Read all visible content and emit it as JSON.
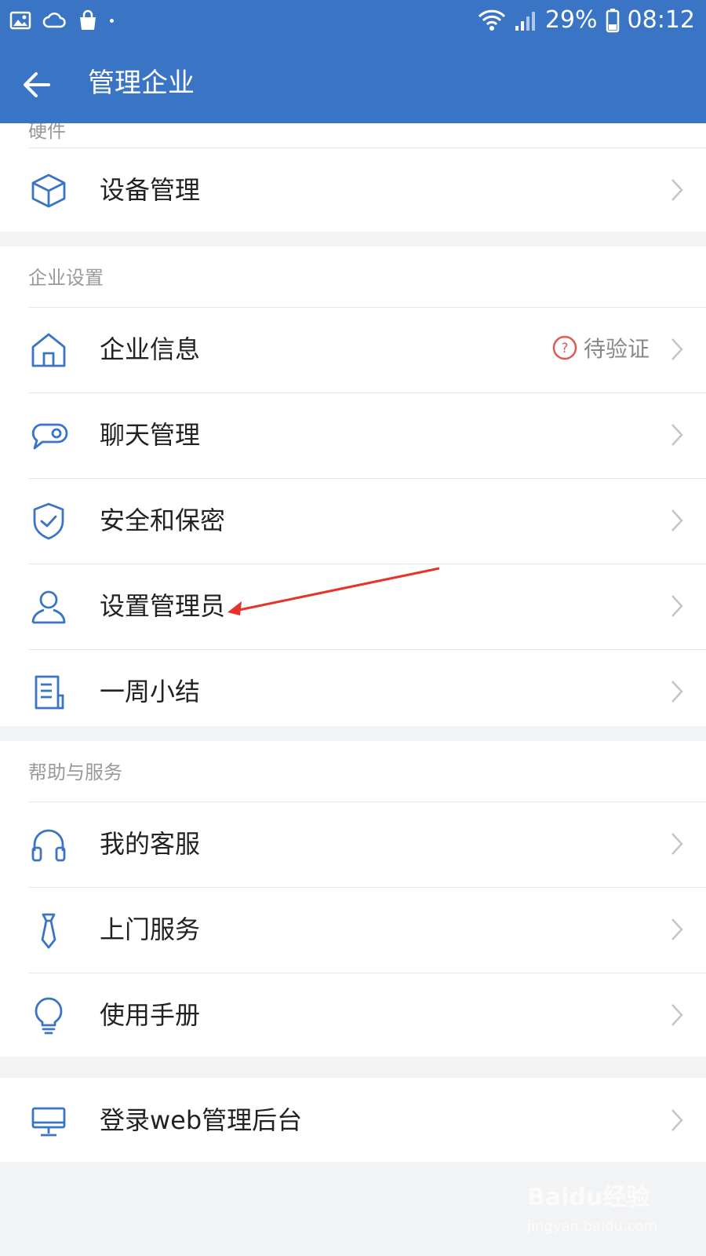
{
  "status_bar": {
    "battery": "29%",
    "time": "08:12"
  },
  "app_bar": {
    "title": "管理企业"
  },
  "top_partial_header": "硬件",
  "device_row": {
    "label": "设备管理"
  },
  "enterprise_settings": {
    "header": "企业设置",
    "items": [
      {
        "label": "企业信息",
        "badge": "待验证",
        "icon": "house-icon"
      },
      {
        "label": "聊天管理",
        "icon": "chat-bubble-icon"
      },
      {
        "label": "安全和保密",
        "icon": "shield-check-icon"
      },
      {
        "label": "设置管理员",
        "icon": "user-icon"
      },
      {
        "label": "一周小结",
        "icon": "document-icon"
      }
    ]
  },
  "help_service": {
    "header": "帮助与服务",
    "items": [
      {
        "label": "我的客服",
        "icon": "headphones-icon"
      },
      {
        "label": "上门服务",
        "icon": "tie-icon"
      },
      {
        "label": "使用手册",
        "icon": "lightbulb-icon"
      }
    ]
  },
  "web_login": {
    "label": "登录web管理后台",
    "icon": "monitor-icon"
  },
  "watermark": {
    "brand": "Baidu经验",
    "url": "jingyan.baidu.com"
  },
  "colors": {
    "primary": "#3a74c4",
    "icon_blue": "#3a74c4",
    "warning_red": "#e05a4f"
  }
}
